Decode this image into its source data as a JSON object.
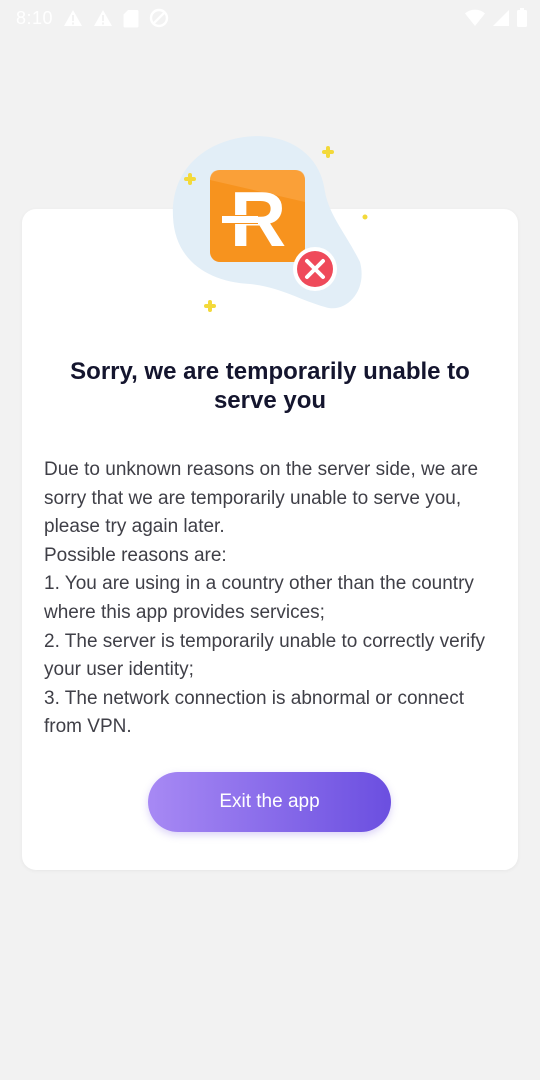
{
  "status_bar": {
    "time": "8:10",
    "left_icons": [
      "warning-icon",
      "warning-icon",
      "sd-card-icon",
      "do-not-disturb-icon"
    ],
    "right_icons": [
      "wifi-icon",
      "cellular-signal-icon",
      "battery-icon"
    ]
  },
  "dialog": {
    "logo_letter": "R",
    "title": "Sorry, we are temporarily unable to serve you",
    "description": "Due to unknown reasons on the server side, we are sorry that we are temporarily unable to serve you, please try again later.\nPossible reasons are:\n1. You are using in a country other than the country where this app provides services;\n2. The server is temporarily unable to correctly verify your user identity;\n3. The network connection is abnormal or connect from VPN.",
    "exit_label": "Exit the app"
  },
  "colors": {
    "background": "#f2f2f2",
    "card": "#ffffff",
    "title": "#14152e",
    "text": "#3f3f47",
    "button_start": "#a789f4",
    "button_end": "#6b4fe0",
    "logo_orange": "#f7931e",
    "error_red": "#ef4a5a",
    "sparkle_yellow": "#f3d93a",
    "blob_blue": "#e2eef7"
  }
}
